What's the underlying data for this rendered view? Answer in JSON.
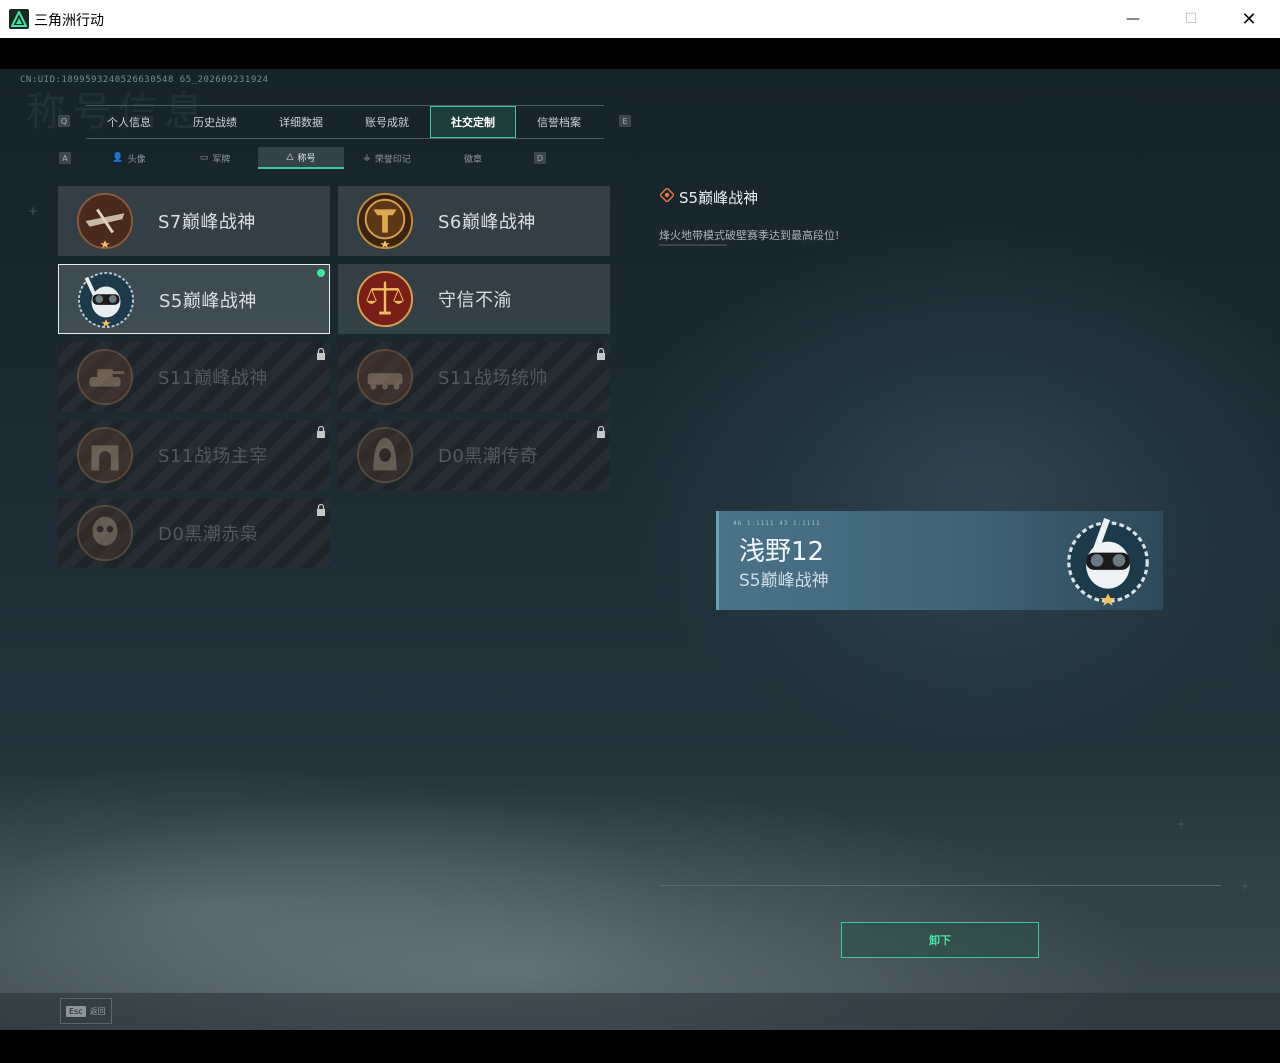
{
  "window": {
    "title": "三角洲行动",
    "minimize": "—",
    "maximize": "☐",
    "close": "✕"
  },
  "header": {
    "uid": "CN:UID:1899593240526630548 65_202609231924",
    "bg_title": "称号信息",
    "tab_key_left": "Q",
    "tab_key_right": "E",
    "subtab_key_left": "A",
    "subtab_key_right": "D"
  },
  "tabs": [
    {
      "label": "个人信息"
    },
    {
      "label": "历史战绩"
    },
    {
      "label": "详细数据"
    },
    {
      "label": "账号成就"
    },
    {
      "label": "社交定制",
      "active": true
    },
    {
      "label": "信誉档案"
    }
  ],
  "subtabs": [
    {
      "label": "头像",
      "icon": "person-icon"
    },
    {
      "label": "军牌",
      "icon": "tag-icon"
    },
    {
      "label": "称号",
      "icon": "triangle-icon",
      "active": true
    },
    {
      "label": "荣誉印记",
      "icon": "wings-icon"
    },
    {
      "label": "徽章",
      "icon": ""
    }
  ],
  "titles": [
    {
      "name": "S7巅峰战神",
      "locked": false,
      "medal": "crossbow-medal"
    },
    {
      "name": "S6巅峰战神",
      "locked": false,
      "medal": "t-emblem-medal"
    },
    {
      "name": "S5巅峰战神",
      "locked": false,
      "selected": true,
      "equipped": true,
      "medal": "diver-skull-medal"
    },
    {
      "name": "守信不渝",
      "locked": false,
      "medal": "scales-medal"
    },
    {
      "name": "S11巅峰战神",
      "locked": true,
      "medal": "tank-medal"
    },
    {
      "name": "S11战场统帅",
      "locked": true,
      "medal": "apc-medal"
    },
    {
      "name": "S11战场主宰",
      "locked": true,
      "medal": "arch-medal"
    },
    {
      "name": "D0黑潮传奇",
      "locked": true,
      "medal": "hooded-medal"
    },
    {
      "name": "D0黑潮赤枭",
      "locked": true,
      "medal": "skull-medal"
    }
  ],
  "detail": {
    "title": "S5巅峰战神",
    "description": "烽火地带模式破壁赛季达到最高段位!"
  },
  "preview": {
    "player_name": "浅野12",
    "title": "S5巅峰战神",
    "codes": "46  1:1111  43  1:1111"
  },
  "actions": {
    "unequip": "卸下",
    "esc_key": "Esc",
    "esc_label": "返回"
  },
  "colors": {
    "accent": "#39c89a",
    "equipped_dot": "#3ee6a2",
    "titlebar": "#ffffff"
  }
}
